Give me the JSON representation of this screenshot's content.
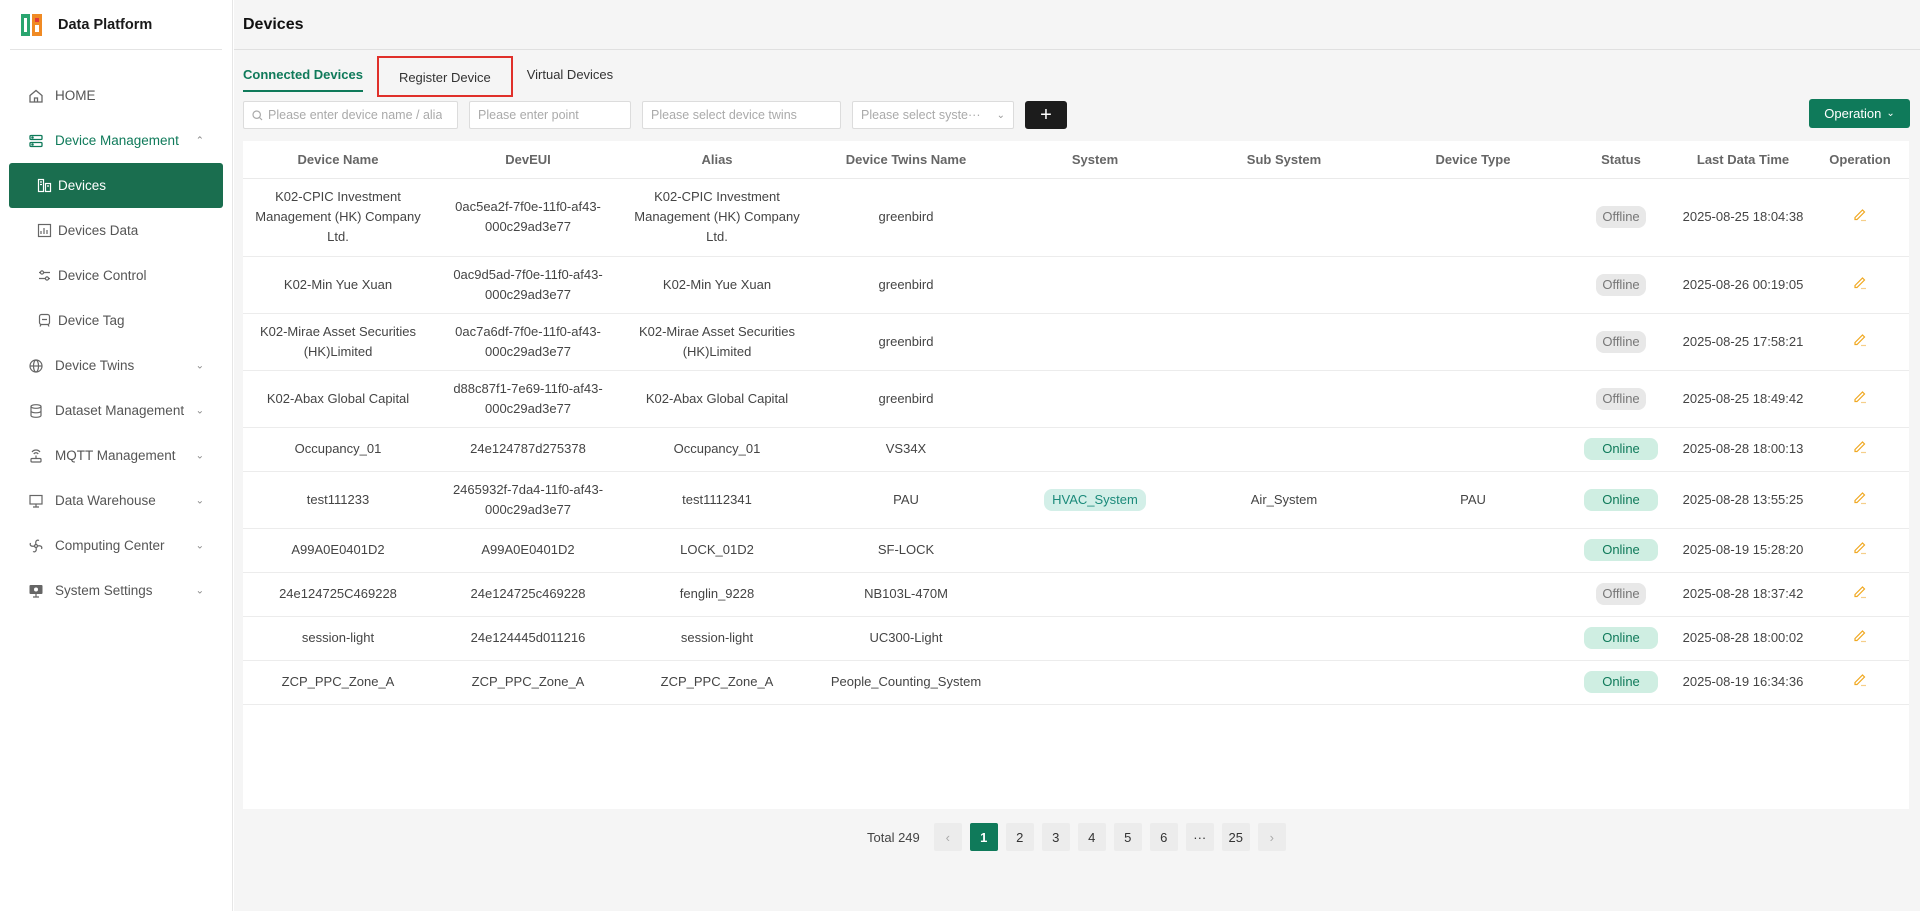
{
  "app": {
    "title": "Data Platform"
  },
  "sidebar": {
    "items": [
      {
        "label": "HOME",
        "icon": "home-icon"
      },
      {
        "label": "Device Management",
        "icon": "device-management-icon"
      },
      {
        "label": "Device Twins",
        "icon": "globe-icon"
      },
      {
        "label": "Dataset Management",
        "icon": "database-icon"
      },
      {
        "label": "MQTT Management",
        "icon": "antenna-icon"
      },
      {
        "label": "Data Warehouse",
        "icon": "warehouse-icon"
      },
      {
        "label": "Computing Center",
        "icon": "fan-icon"
      },
      {
        "label": "System Settings",
        "icon": "monitor-icon"
      }
    ],
    "sub_items": [
      {
        "label": "Devices",
        "icon": "devices-icon"
      },
      {
        "label": "Devices Data",
        "icon": "chart-doc-icon"
      },
      {
        "label": "Device Control",
        "icon": "sliders-icon"
      },
      {
        "label": "Device Tag",
        "icon": "tag-icon"
      }
    ]
  },
  "page": {
    "title": "Devices"
  },
  "tabs": [
    "Connected Devices",
    "Register Device",
    "Virtual Devices"
  ],
  "filters": {
    "name_placeholder": "Please enter device name / alia",
    "point_placeholder": "Please enter point",
    "twins_placeholder": "Please select device twins",
    "system_placeholder": "Please select syste···",
    "add_label": "+",
    "operation_label": "Operation"
  },
  "table": {
    "headers": [
      "Device Name",
      "DevEUI",
      "Alias",
      "Device Twins Name",
      "System",
      "Sub System",
      "Device Type",
      "Status",
      "Last Data Time",
      "Operation"
    ],
    "rows": [
      {
        "name": "K02-CPIC Investment Management (HK) Company Ltd.",
        "deveui": "0ac5ea2f-7f0e-11f0-af43-000c29ad3e77",
        "alias": "K02-CPIC Investment Management (HK) Company Ltd.",
        "twins": "greenbird",
        "system": "",
        "subsystem": "",
        "type": "",
        "status": "Offline",
        "time": "2025-08-25 18:04:38"
      },
      {
        "name": "K02-Min Yue Xuan",
        "deveui": "0ac9d5ad-7f0e-11f0-af43-000c29ad3e77",
        "alias": "K02-Min Yue Xuan",
        "twins": "greenbird",
        "system": "",
        "subsystem": "",
        "type": "",
        "status": "Offline",
        "time": "2025-08-26 00:19:05"
      },
      {
        "name": "K02-Mirae Asset Securities (HK)Limited",
        "deveui": "0ac7a6df-7f0e-11f0-af43-000c29ad3e77",
        "alias": "K02-Mirae Asset Securities (HK)Limited",
        "twins": "greenbird",
        "system": "",
        "subsystem": "",
        "type": "",
        "status": "Offline",
        "time": "2025-08-25 17:58:21"
      },
      {
        "name": "K02-Abax Global Capital",
        "deveui": "d88c87f1-7e69-11f0-af43-000c29ad3e77",
        "alias": "K02-Abax Global Capital",
        "twins": "greenbird",
        "system": "",
        "subsystem": "",
        "type": "",
        "status": "Offline",
        "time": "2025-08-25 18:49:42"
      },
      {
        "name": "Occupancy_01",
        "deveui": "24e124787d275378",
        "alias": "Occupancy_01",
        "twins": "VS34X",
        "system": "",
        "subsystem": "",
        "type": "",
        "status": "Online",
        "time": "2025-08-28 18:00:13"
      },
      {
        "name": "test111233",
        "deveui": "2465932f-7da4-11f0-af43-000c29ad3e77",
        "alias": "test1112341",
        "twins": "PAU",
        "system": "HVAC_System",
        "subsystem": "Air_System",
        "type": "PAU",
        "status": "Online",
        "time": "2025-08-28 13:55:25"
      },
      {
        "name": "A99A0E0401D2",
        "deveui": "A99A0E0401D2",
        "alias": "LOCK_01D2",
        "twins": "SF-LOCK",
        "system": "",
        "subsystem": "",
        "type": "",
        "status": "Online",
        "time": "2025-08-19 15:28:20"
      },
      {
        "name": "24e124725C469228",
        "deveui": "24e124725c469228",
        "alias": "fenglin_9228",
        "twins": "NB103L-470M",
        "system": "",
        "subsystem": "",
        "type": "",
        "status": "Offline",
        "time": "2025-08-28 18:37:42"
      },
      {
        "name": "session-light",
        "deveui": "24e124445d011216",
        "alias": "session-light",
        "twins": "UC300-Light",
        "system": "",
        "subsystem": "",
        "type": "",
        "status": "Online",
        "time": "2025-08-28 18:00:02"
      },
      {
        "name": "ZCP_PPC_Zone_A",
        "deveui": "ZCP_PPC_Zone_A",
        "alias": "ZCP_PPC_Zone_A",
        "twins": "People_Counting_System",
        "system": "",
        "subsystem": "",
        "type": "",
        "status": "Online",
        "time": "2025-08-19 16:34:36"
      }
    ]
  },
  "pagination": {
    "total_label": "Total 249",
    "pages": [
      "1",
      "2",
      "3",
      "4",
      "5",
      "6",
      "···",
      "25"
    ],
    "current": "1",
    "prev": "‹",
    "next": "›"
  },
  "colors": {
    "primary": "#0f7a5a",
    "highlight_border": "#e0302a",
    "edit_icon": "#f0a820"
  }
}
